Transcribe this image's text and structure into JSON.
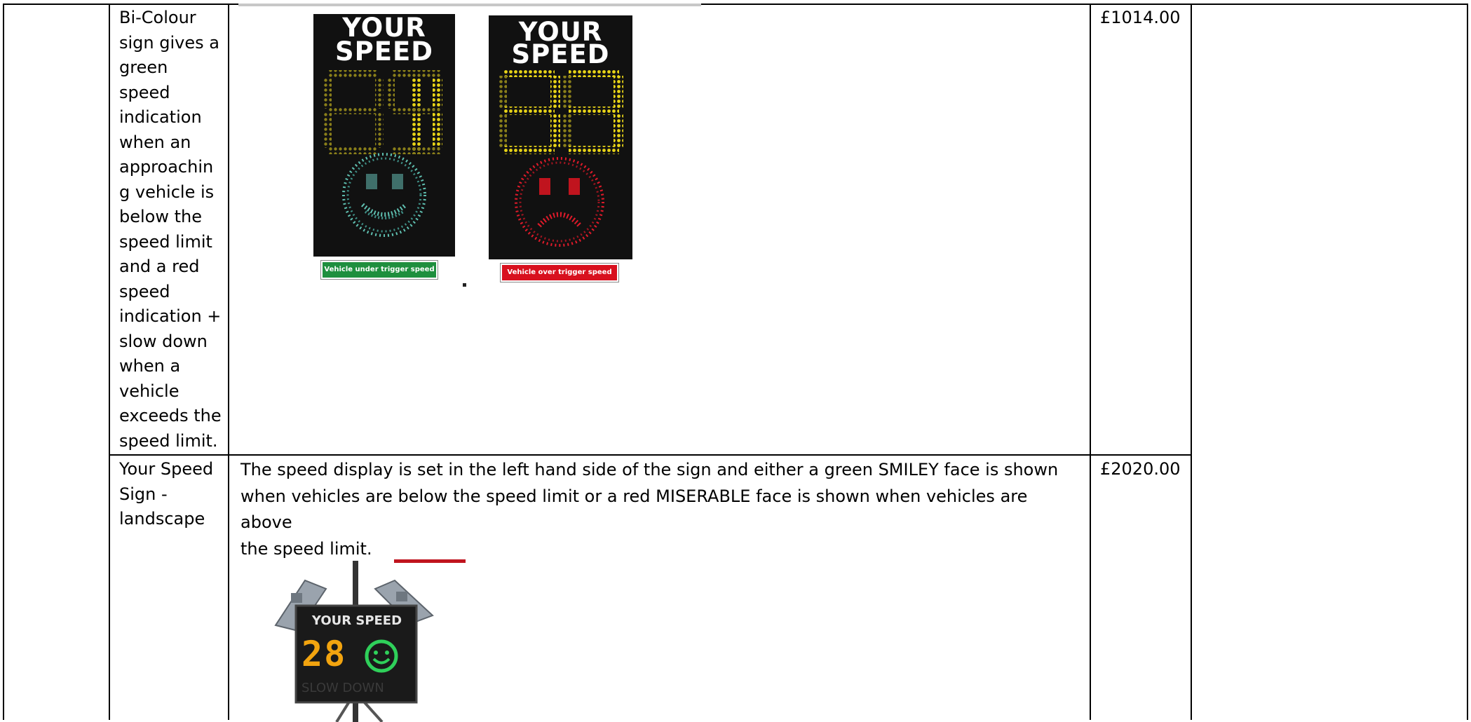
{
  "rows": [
    {
      "name": "",
      "description": "Bi-Colour sign gives a green speed indication when an approachin g vehicle is below the speed limit and a red speed indication + slow down when a vehicle exceeds the speed limit.",
      "description_lines": [
        "Bi-Colour",
        "sign gives a",
        "green",
        "speed",
        "indication",
        "when an",
        "approachin",
        "g vehicle is",
        "below the",
        "speed limit",
        "and a red",
        "speed",
        "indication +",
        "slow down",
        "when a",
        "vehicle",
        "exceeds the",
        "speed limit."
      ],
      "price": "£1014.00",
      "images": {
        "sign_green": {
          "title_line1": "YOUR",
          "title_line2": "SPEED",
          "digits": "88",
          "face": "smiley",
          "badge": "Vehicle under trigger speed",
          "badge_color": "#1e8f3e"
        },
        "sign_red": {
          "title_line1": "YOUR",
          "title_line2": "SPEED",
          "digits": "88",
          "face": "sad",
          "badge": "Vehicle over trigger speed",
          "badge_color": "#d8101e"
        }
      }
    },
    {
      "name_lines": [
        "Your Speed",
        "Sign -",
        "landscape"
      ],
      "description_lines": [
        "The speed display is set in the left hand side of the sign and either a green SMILEY face is shown",
        "when vehicles are below the speed limit or a red MISERABLE face is shown when vehicles are above",
        "the speed limit."
      ],
      "price": "£2020.00",
      "image": {
        "title": "YOUR SPEED",
        "digits": "28",
        "subtext": "SLOW DOWN",
        "face": "smiley"
      }
    }
  ],
  "colors": {
    "amber": "#f2a40f",
    "yellow": "#e8d417",
    "green_led": "#2fd05a",
    "red_led": "#e01a2a",
    "teal_led": "#5fbfb0"
  }
}
